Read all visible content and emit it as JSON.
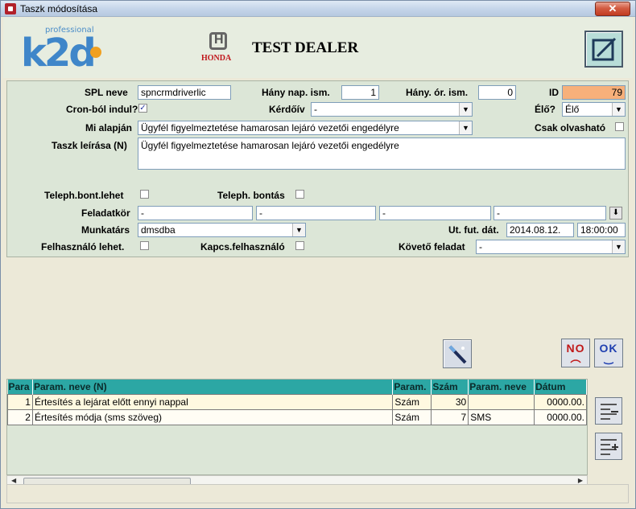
{
  "window": {
    "title": "Taszk módosítása",
    "close": "✕"
  },
  "header": {
    "logo_small": "professional",
    "logo_main": "k2d",
    "brand_word": "HONDA",
    "dealer_name": "TEST DEALER"
  },
  "form": {
    "spl_label": "SPL neve",
    "spl_value": "spncrmdriverlic",
    "hany_nap_label": "Hány nap. ism.",
    "hany_nap_value": "1",
    "hany_or_label": "Hány. ór. ism.",
    "hany_or_value": "0",
    "id_label": "ID",
    "id_value": "79",
    "cron_label": "Cron-ból indul?",
    "cron_checked": "✓",
    "kerdoiv_label": "Kérdőív",
    "kerdoiv_value": "-",
    "elo_label": "Élő?",
    "elo_value": "Élő",
    "mi_alapjan_label": "Mi alapján",
    "mi_alapjan_value": "Ügyfél figyelmeztetése hamarosan lejáró vezetői engedélyre",
    "csak_olv_label": "Csak olvasható",
    "leiras_label": "Taszk leírása (N)",
    "leiras_value": "Ügyfél figyelmeztetése hamarosan lejáró vezetői engedélyre",
    "teleph_bont_lehet_label": "Teleph.bont.lehet",
    "teleph_bontas_label": "Teleph. bontás",
    "feladatkor_label": "Feladatkör",
    "feladatkor_values": [
      "-",
      "-",
      "-",
      "-"
    ],
    "munkatars_label": "Munkatárs",
    "munkatars_value": "dmsdba",
    "ut_fut_label": "Ut. fut. dát.",
    "ut_fut_date": "2014.08.12.",
    "ut_fut_time": "18:00:00",
    "felh_lehet_label": "Felhasználó lehet.",
    "kapcs_felh_label": "Kapcs.felhasználó",
    "koveto_label": "Követő feladat",
    "koveto_value": "-"
  },
  "buttons": {
    "no_label": "NO",
    "ok_label": "OK"
  },
  "table": {
    "headers": [
      "Para",
      "Param. neve (N)",
      "Param.",
      "Szám",
      "Param. neve",
      "Dátum"
    ],
    "rows": [
      [
        "1",
        "Értesítés a lejárat előtt ennyi nappal",
        "Szám",
        "30",
        "",
        "0000.00."
      ],
      [
        "2",
        "Értesítés módja (sms szöveg)",
        "Szám",
        "7",
        "SMS",
        "0000.00."
      ]
    ]
  },
  "colors": {
    "id_bg": "#f7b07a",
    "grid_header": "#2ca7a4",
    "panel": "#dce6d7"
  }
}
